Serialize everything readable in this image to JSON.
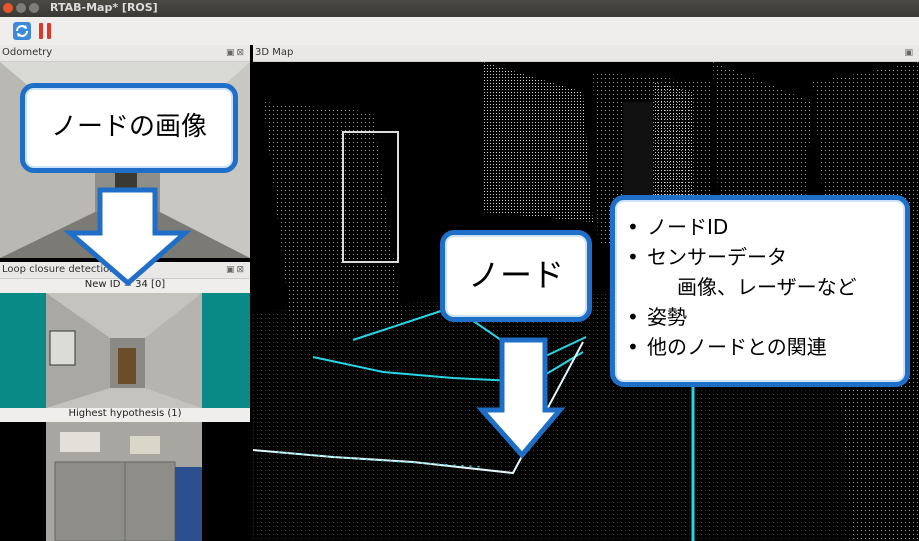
{
  "window": {
    "title": "RTAB-Map* [ROS]"
  },
  "panels": {
    "odometry": {
      "title": "Odometry"
    },
    "map3d": {
      "title": "3D Map"
    },
    "loop": {
      "title": "Loop closure detection",
      "new_id": "New ID = 34 [0]",
      "hypothesis": "Highest hypothesis (1)"
    }
  },
  "icons": {
    "refresh": "refresh-icon",
    "pause": "pause-icon",
    "float": "float-icon",
    "close": "close-icon"
  },
  "callouts": {
    "node_image": "ノードの画像",
    "node": "ノード",
    "info": {
      "items": [
        "ノードID",
        "センサーデータ",
        "姿勢",
        "他のノードとの関連"
      ],
      "sensor_sub": "画像、レーザーなど"
    }
  },
  "colors": {
    "accent": "#1f6fc8",
    "teal": "#0a8a86",
    "cyan": "#29d6e6"
  }
}
